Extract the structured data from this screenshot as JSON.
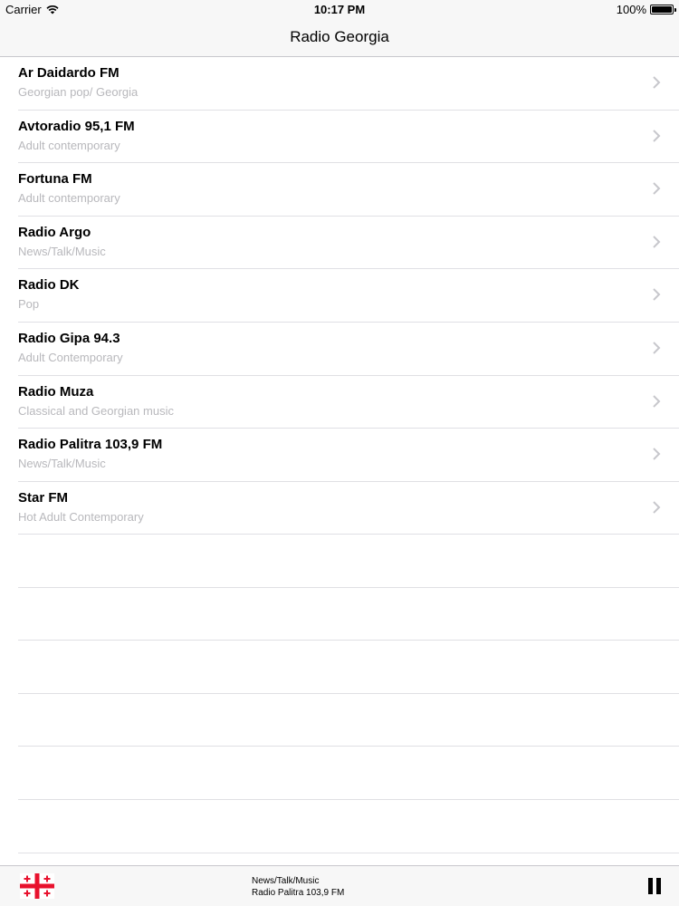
{
  "status_bar": {
    "carrier": "Carrier",
    "time": "10:17 PM",
    "battery": "100%"
  },
  "nav": {
    "title": "Radio Georgia"
  },
  "stations": [
    {
      "name": "Ar Daidardo FM",
      "genre": "Georgian pop/ Georgia"
    },
    {
      "name": "Avtoradio 95,1 FM",
      "genre": "Adult contemporary"
    },
    {
      "name": "Fortuna FM",
      "genre": "Adult contemporary"
    },
    {
      "name": "Radio Argo",
      "genre": "News/Talk/Music"
    },
    {
      "name": "Radio DK",
      "genre": "Pop"
    },
    {
      "name": "Radio Gipa 94.3",
      "genre": "Adult Contemporary"
    },
    {
      "name": "Radio Muza",
      "genre": "Classical and Georgian music"
    },
    {
      "name": "Radio Palitra 103,9 FM",
      "genre": "News/Talk/Music"
    },
    {
      "name": "Star FM",
      "genre": "Hot Adult Contemporary"
    }
  ],
  "player": {
    "genre": "News/Talk/Music",
    "station": "Radio Palitra 103,9 FM",
    "flag_icon": "georgia-flag-icon",
    "control_icon": "pause-icon"
  },
  "colors": {
    "flag_cross": "#e8112d",
    "subtitle": "#b8b8bc",
    "bar_background": "#f7f7f7"
  }
}
